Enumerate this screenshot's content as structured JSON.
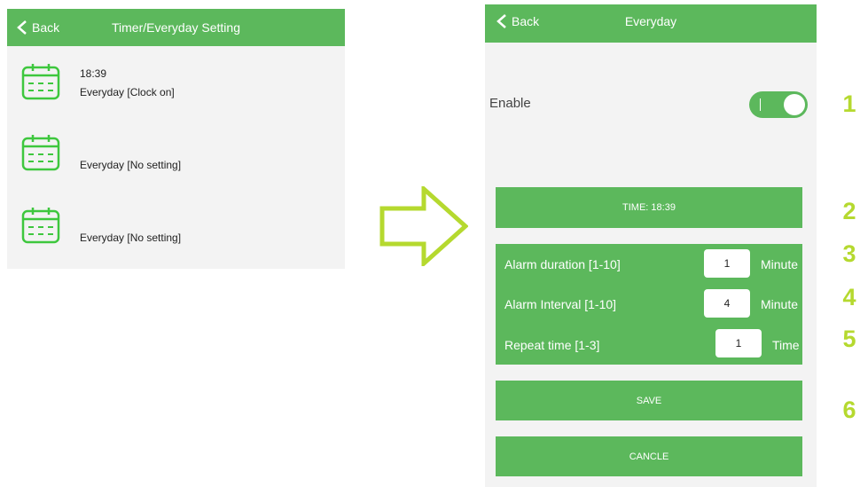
{
  "left": {
    "back_label": "Back",
    "title": "Timer/Everyday Setting",
    "items": [
      {
        "time": "18:39",
        "label": "Everyday [Clock on]"
      },
      {
        "time": "",
        "label": "Everyday [No setting]"
      },
      {
        "time": "",
        "label": "Everyday [No setting]"
      }
    ]
  },
  "right": {
    "back_label": "Back",
    "title": "Everyday",
    "enable_label": "Enable",
    "enable_on": true,
    "time_button": "TIME: 18:39",
    "settings": [
      {
        "label": "Alarm duration [1-10]",
        "value": "1",
        "unit": "Minute"
      },
      {
        "label": "Alarm Interval [1-10]",
        "value": "4",
        "unit": "Minute"
      },
      {
        "label": "Repeat time [1-3]",
        "value": "1",
        "unit": "Time"
      }
    ],
    "save_button": "SAVE",
    "cancel_button": "CANCLE"
  },
  "annotations": [
    "1",
    "2",
    "3",
    "4",
    "5",
    "6"
  ],
  "colors": {
    "accent_green": "#5cb85c",
    "annotation_yellow": "#b5d92f"
  },
  "icons": {
    "back": "chevron-left-icon",
    "list_item": "calendar-icon",
    "transition": "arrow-right-outline-icon"
  }
}
